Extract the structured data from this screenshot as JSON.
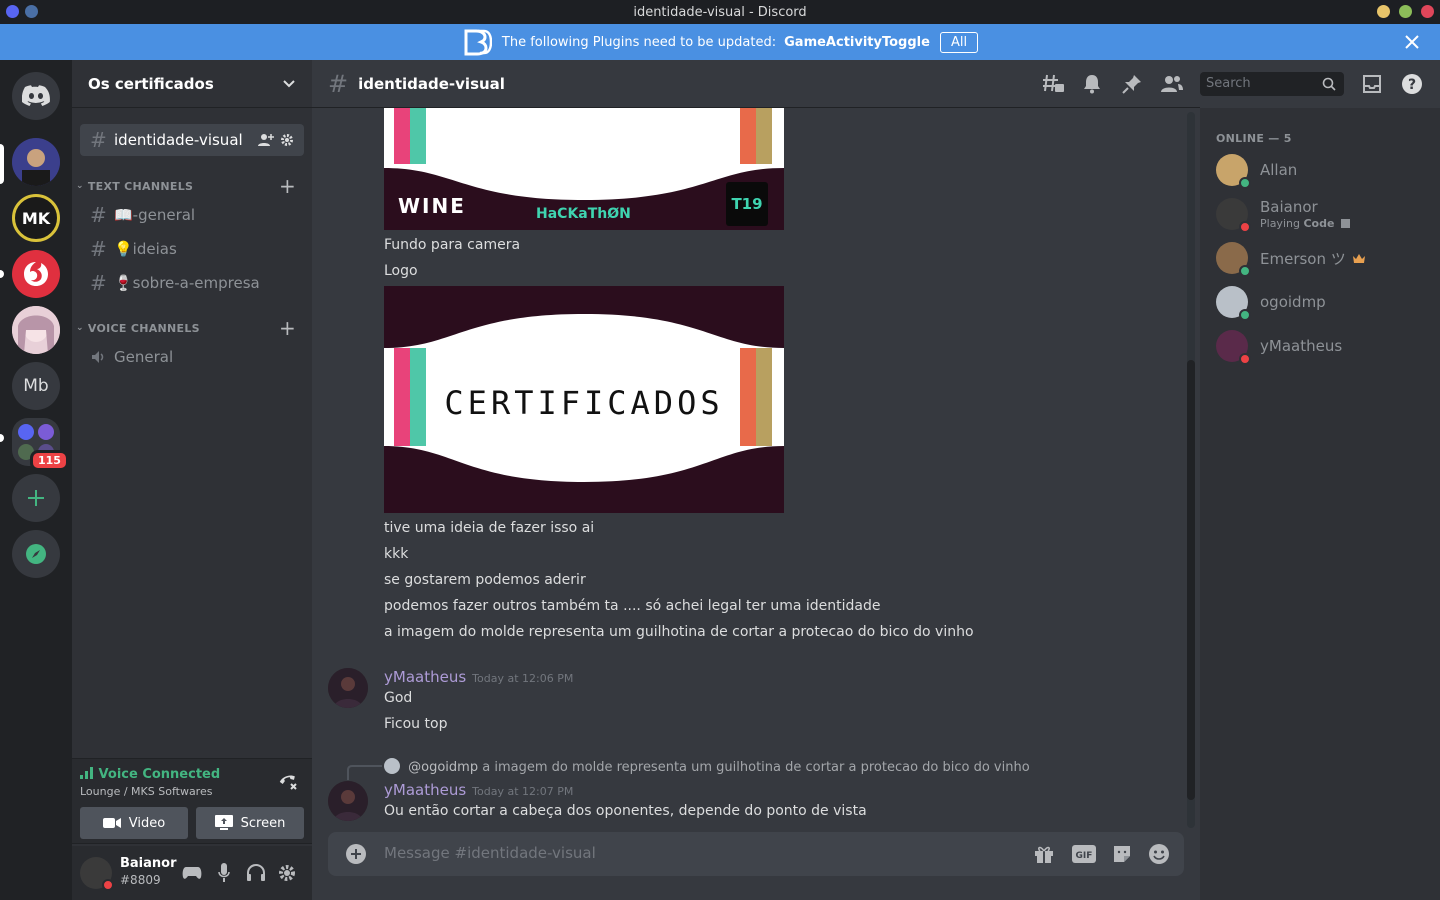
{
  "window": {
    "title": "identidade-visual - Discord",
    "titlebar_dots": [
      "#e8c46a",
      "#8cbd59",
      "#e0465a"
    ]
  },
  "banner": {
    "text": "The following Plugins need to be updated:",
    "plugin": "GameActivityToggle",
    "all_button": "All"
  },
  "guilds": {
    "mb_label": "Mb",
    "unread_badge": "115"
  },
  "server": {
    "name": "Os certificados"
  },
  "channels": {
    "active": "identidade-visual",
    "text_category": "TEXT CHANNELS",
    "text": [
      {
        "label": "📖-general"
      },
      {
        "label": "💡ideias"
      },
      {
        "label": "🍷sobre-a-empresa"
      }
    ],
    "voice_category": "VOICE CHANNELS",
    "voice": [
      {
        "label": "General"
      }
    ]
  },
  "voice_panel": {
    "status": "Voice Connected",
    "location": "Lounge / MKS Softwares",
    "video_label": "Video",
    "screen_label": "Screen"
  },
  "user": {
    "name": "Baianor",
    "tag": "#8809"
  },
  "chat": {
    "channel_name": "identidade-visual",
    "search_placeholder": "Search",
    "composer_placeholder": "Message #identidade-visual",
    "top_image": {
      "left_text": "WINE",
      "center_text": "HaCKaThØN",
      "right_text": "T19"
    },
    "lines_1": [
      "Fundo para camera",
      "Logo"
    ],
    "certificate_text": "CERTIFICADOS",
    "lines_2": [
      "tive uma ideia de fazer isso ai",
      "kkk",
      "se gostarem podemos aderir",
      "podemos fazer outros também ta .... só achei legal ter uma identidade",
      "a imagem do molde representa um guilhotina de cortar a protecao do bico do vinho"
    ],
    "msg2": {
      "author": "yMaatheus",
      "timestamp": "Today at 12:06 PM",
      "lines": [
        "God",
        "Ficou top"
      ]
    },
    "reply": {
      "mention": "@ogoidmp",
      "text": "a imagem do molde representa um guilhotina de cortar a protecao do bico do vinho"
    },
    "msg3": {
      "author": "yMaatheus",
      "timestamp": "Today at 12:07 PM",
      "line": "Ou então cortar a cabeça dos oponentes, depende do ponto de vista"
    }
  },
  "members": {
    "header": "ONLINE — 5",
    "list": [
      {
        "name": "Allan",
        "activity": "",
        "status": "online",
        "color": "#c8a46a"
      },
      {
        "name": "Baianor",
        "activity_prefix": "Playing",
        "activity_bold": "Code",
        "status": "dnd",
        "color": "#3a3a3a"
      },
      {
        "name": "Emerson ツ",
        "activity": "",
        "status": "online",
        "color": "#8a6a4a"
      },
      {
        "name": "ogoidmp",
        "activity": "",
        "status": "online",
        "color": "#b9c0c8"
      },
      {
        "name": "yMaatheus",
        "activity": "",
        "status": "dnd",
        "color": "#5a2a4a"
      }
    ]
  },
  "colors": {
    "banner": "#4a90e2",
    "online": "#43b581",
    "dnd": "#ed4245",
    "author": "#ad9bd6"
  }
}
